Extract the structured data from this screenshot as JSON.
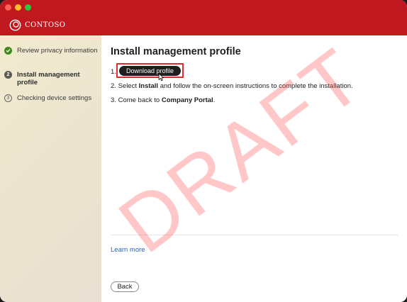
{
  "brand": {
    "name": "CONTOSO"
  },
  "sidebar": {
    "steps": [
      {
        "label": "Review privacy information",
        "state": "done"
      },
      {
        "label": "Install management profile",
        "state": "current",
        "number": "2"
      },
      {
        "label": "Checking device settings",
        "state": "pending",
        "number": "3"
      }
    ]
  },
  "main": {
    "heading": "Install management profile",
    "step1_number": "1.",
    "download_button": "Download profile",
    "step2_number": "2.",
    "step2_pre": "Select ",
    "step2_bold": "Install",
    "step2_post": " and follow the on-screen instructions to complete the installation.",
    "step3_number": "3.",
    "step3_pre": "Come back to ",
    "step3_bold": "Company Portal",
    "step3_post": ".",
    "learn_more": "Learn more",
    "back_button": "Back"
  },
  "watermark": "DRAFT",
  "colors": {
    "titlebar": "#c0181f",
    "accent_link": "#2a64b7",
    "highlight": "#e32a33",
    "done": "#3f8a1c"
  }
}
